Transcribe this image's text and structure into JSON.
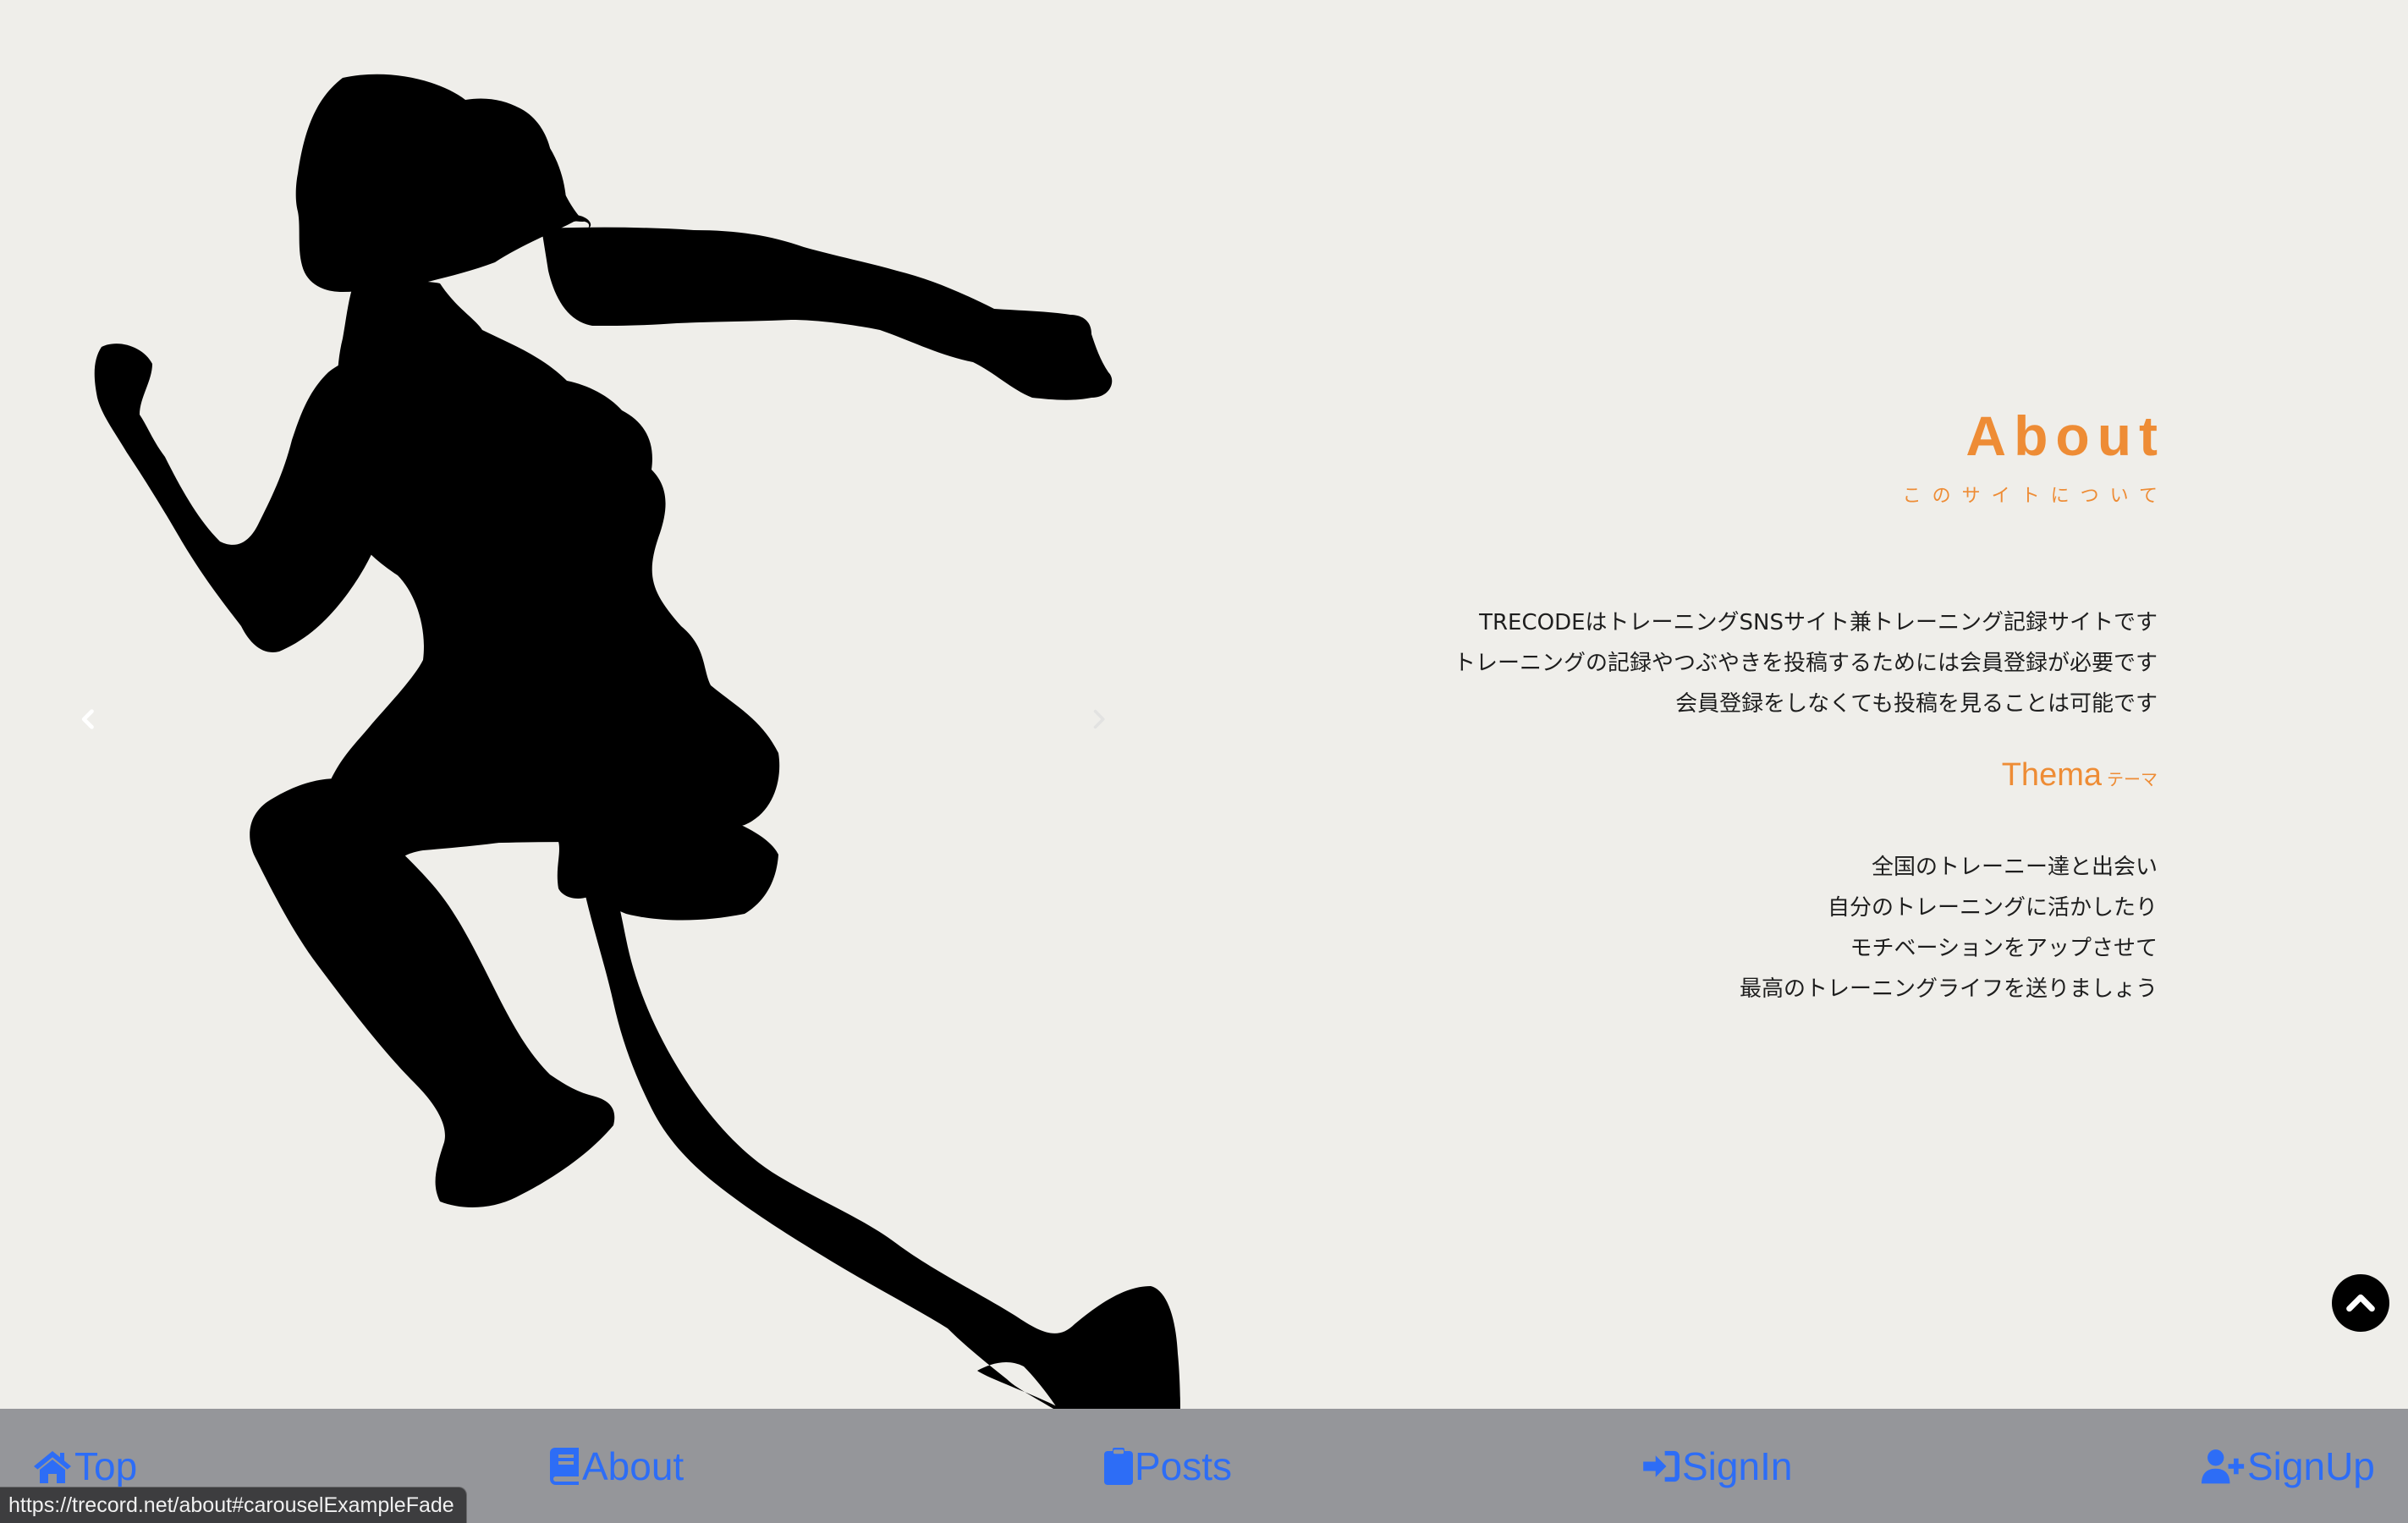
{
  "carousel": {
    "prev_icon": "chevron-left-icon",
    "next_icon": "chevron-right-icon"
  },
  "about": {
    "title": "About",
    "subtitle": "このサイトについて",
    "body_lines": [
      "TRECODEはトレーニングSNSサイト兼トレーニング記録サイトです",
      "トレーニングの記録やつぶやきを投稿するためには会員登録が必要です",
      "会員登録をしなくても投稿を見ることは可能です"
    ],
    "thema_title": "Thema",
    "thema_subtitle": "テーマ",
    "thema_lines": [
      "全国のトレーニー達と出会い",
      "自分のトレーニングに活かしたり",
      "モチベーションをアップさせて",
      "最高のトレーニングライフを送りましょう"
    ]
  },
  "back_to_top": {
    "icon": "chevron-up-icon"
  },
  "nav": {
    "top_label": "Top",
    "about_label": "About",
    "posts_label": "Posts",
    "signin_label": "SignIn",
    "signup_label": "SignUp"
  },
  "status_bar": {
    "url": "https://trecord.net/about#carouselExampleFade"
  },
  "colors": {
    "background": "#efeeea",
    "accent": "#ee8c35",
    "nav_background": "#95969a",
    "nav_link": "#2d6df6"
  }
}
